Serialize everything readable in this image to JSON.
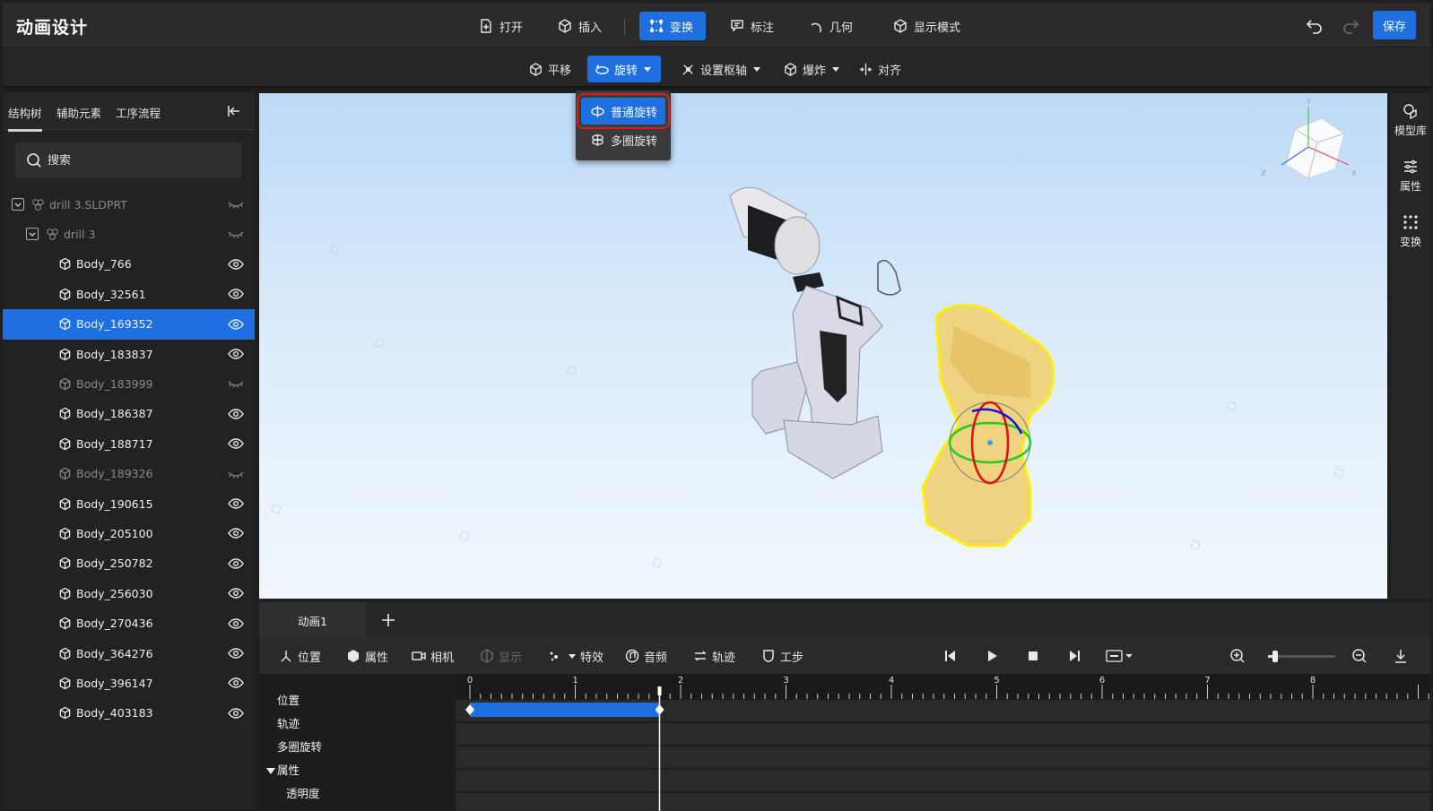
{
  "app": {
    "title": "动画设计"
  },
  "toolbar": {
    "open": "打开",
    "insert": "插入",
    "transform": "变换",
    "annotate": "标注",
    "geometry": "几何",
    "display_mode": "显示模式",
    "save": "保存"
  },
  "subtoolbar": {
    "translate": "平移",
    "rotate": "旋转",
    "set_pivot": "设置枢轴",
    "explode": "爆炸",
    "align": "对齐"
  },
  "rotate_menu": {
    "normal": "普通旋转",
    "multi": "多圈旋转"
  },
  "left_panel": {
    "tabs": [
      "结构树",
      "辅助元素",
      "工序流程"
    ],
    "search_placeholder": "搜索",
    "tree": [
      {
        "label": "drill 3.SLDPRT",
        "level": 0,
        "visible": false,
        "dim": true
      },
      {
        "label": "drill 3",
        "level": 1,
        "visible": false,
        "dim": true
      },
      {
        "label": "Body_766",
        "level": 2,
        "visible": true
      },
      {
        "label": "Body_32561",
        "level": 2,
        "visible": true
      },
      {
        "label": "Body_169352",
        "level": 2,
        "visible": true,
        "selected": true
      },
      {
        "label": "Body_183837",
        "level": 2,
        "visible": true
      },
      {
        "label": "Body_183999",
        "level": 2,
        "visible": false,
        "dim": true
      },
      {
        "label": "Body_186387",
        "level": 2,
        "visible": true
      },
      {
        "label": "Body_188717",
        "level": 2,
        "visible": true
      },
      {
        "label": "Body_189326",
        "level": 2,
        "visible": false,
        "dim": true
      },
      {
        "label": "Body_190615",
        "level": 2,
        "visible": true
      },
      {
        "label": "Body_205100",
        "level": 2,
        "visible": true
      },
      {
        "label": "Body_250782",
        "level": 2,
        "visible": true
      },
      {
        "label": "Body_256030",
        "level": 2,
        "visible": true
      },
      {
        "label": "Body_270436",
        "level": 2,
        "visible": true
      },
      {
        "label": "Body_364276",
        "level": 2,
        "visible": true
      },
      {
        "label": "Body_396147",
        "level": 2,
        "visible": true
      },
      {
        "label": "Body_403183",
        "level": 2,
        "visible": true
      }
    ]
  },
  "right_rail": {
    "model_library": "模型库",
    "properties": "属性",
    "transform": "变换"
  },
  "view_cube": {
    "x": "X",
    "y": "Y",
    "z": "Z"
  },
  "animation": {
    "tab": "动画1",
    "tools": {
      "position": "位置",
      "properties": "属性",
      "camera": "相机",
      "display": "显示",
      "effects": "特效",
      "audio": "音频",
      "trajectory": "轨迹",
      "step": "工步"
    },
    "tracks": {
      "position": "位置",
      "trajectory": "轨迹",
      "multi_rotate": "多圈旋转",
      "properties": "属性",
      "opacity": "透明度"
    },
    "ruler_labels": [
      "0",
      "1",
      "2",
      "3",
      "4",
      "5",
      "6",
      "7",
      "8"
    ],
    "playhead_time": 1.8,
    "position_clip": {
      "start": 0,
      "end": 1.8
    }
  },
  "colors": {
    "accent": "#1e6fe0",
    "highlight": "#d61f1f",
    "selection_part": "#f0d27a"
  }
}
